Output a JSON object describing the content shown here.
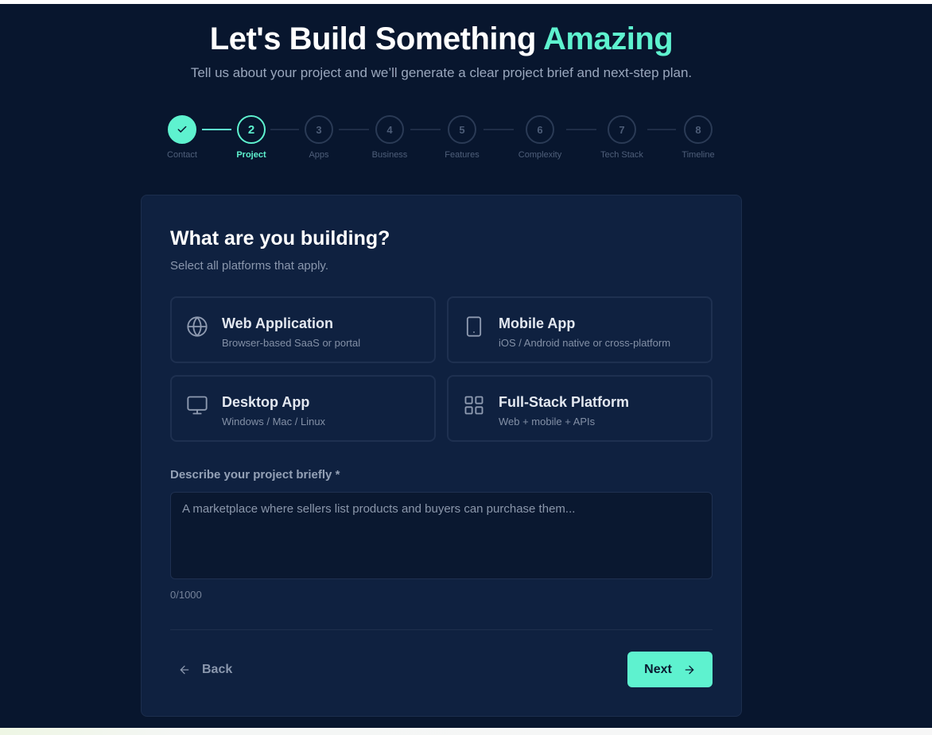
{
  "hero": {
    "title_main": "Let's Build Something",
    "title_accent": "Amazing",
    "subtitle": "Tell us about your project and we’ll generate a clear project brief and next-step plan."
  },
  "stepper": {
    "steps": [
      {
        "number": "✓",
        "label": "Contact"
      },
      {
        "number": "2",
        "label": "Project"
      },
      {
        "number": "3",
        "label": "Apps"
      },
      {
        "number": "4",
        "label": "Business"
      },
      {
        "number": "5",
        "label": "Features"
      },
      {
        "number": "6",
        "label": "Complexity"
      },
      {
        "number": "7",
        "label": "Tech Stack"
      },
      {
        "number": "8",
        "label": "Timeline"
      }
    ],
    "current_step": 2
  },
  "form": {
    "title": "What are you building?",
    "subtitle": "Select all platforms that apply.",
    "options": [
      {
        "title": "Web Application",
        "desc": "Browser-based SaaS or portal",
        "icon": "globe-icon"
      },
      {
        "title": "Mobile App",
        "desc": "iOS / Android native or cross-platform",
        "icon": "smartphone-icon"
      },
      {
        "title": "Desktop App",
        "desc": "Windows / Mac / Linux",
        "icon": "monitor-icon"
      },
      {
        "title": "Full-Stack Platform",
        "desc": "Web + mobile + APIs",
        "icon": "grid-icon"
      }
    ],
    "description_label": "Describe your project briefly *",
    "description_value": "",
    "description_placeholder": "A marketplace where sellers list products and buyers can purchase them...",
    "char_count": "0/1000",
    "back_label": "Back",
    "next_label": "Next"
  },
  "colors": {
    "accent": "#5ef2cf",
    "background": "#08162e",
    "card": "#0f2140"
  }
}
